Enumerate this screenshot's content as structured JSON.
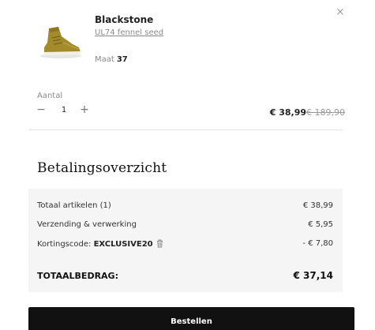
{
  "cart_item": {
    "name": "Blackstone",
    "variant": "UL74 fennel seed",
    "size_label": "Maat",
    "size_value": "37",
    "quantity_label": "Aantal",
    "quantity": "1",
    "minus_symbol": "−",
    "plus_symbol": "+",
    "price": "€ 38,99",
    "original_price": "€ 189,90",
    "close_symbol": "×"
  },
  "summary": {
    "title": "Betalingsoverzicht",
    "rows": [
      {
        "label": "Totaal artikelen (1)",
        "value": "€ 38,99"
      },
      {
        "label": "Verzending & verwerking",
        "value": "€ 5,95"
      }
    ],
    "discount": {
      "label_prefix": "Kortingscode: ",
      "code": "EXCLUSIVE20",
      "value": "- € 7,80"
    },
    "total_label": "TOTAALBEDRAG:",
    "total_value": "€ 37,14"
  },
  "order_button": {
    "label": "Bestellen"
  },
  "colors": {
    "button_bg": "#111111",
    "summary_bg": "#f5f5f5",
    "muted_text": "#8a8a8a"
  },
  "icons": [
    "close-icon",
    "trash-icon",
    "minus-icon",
    "plus-icon"
  ]
}
